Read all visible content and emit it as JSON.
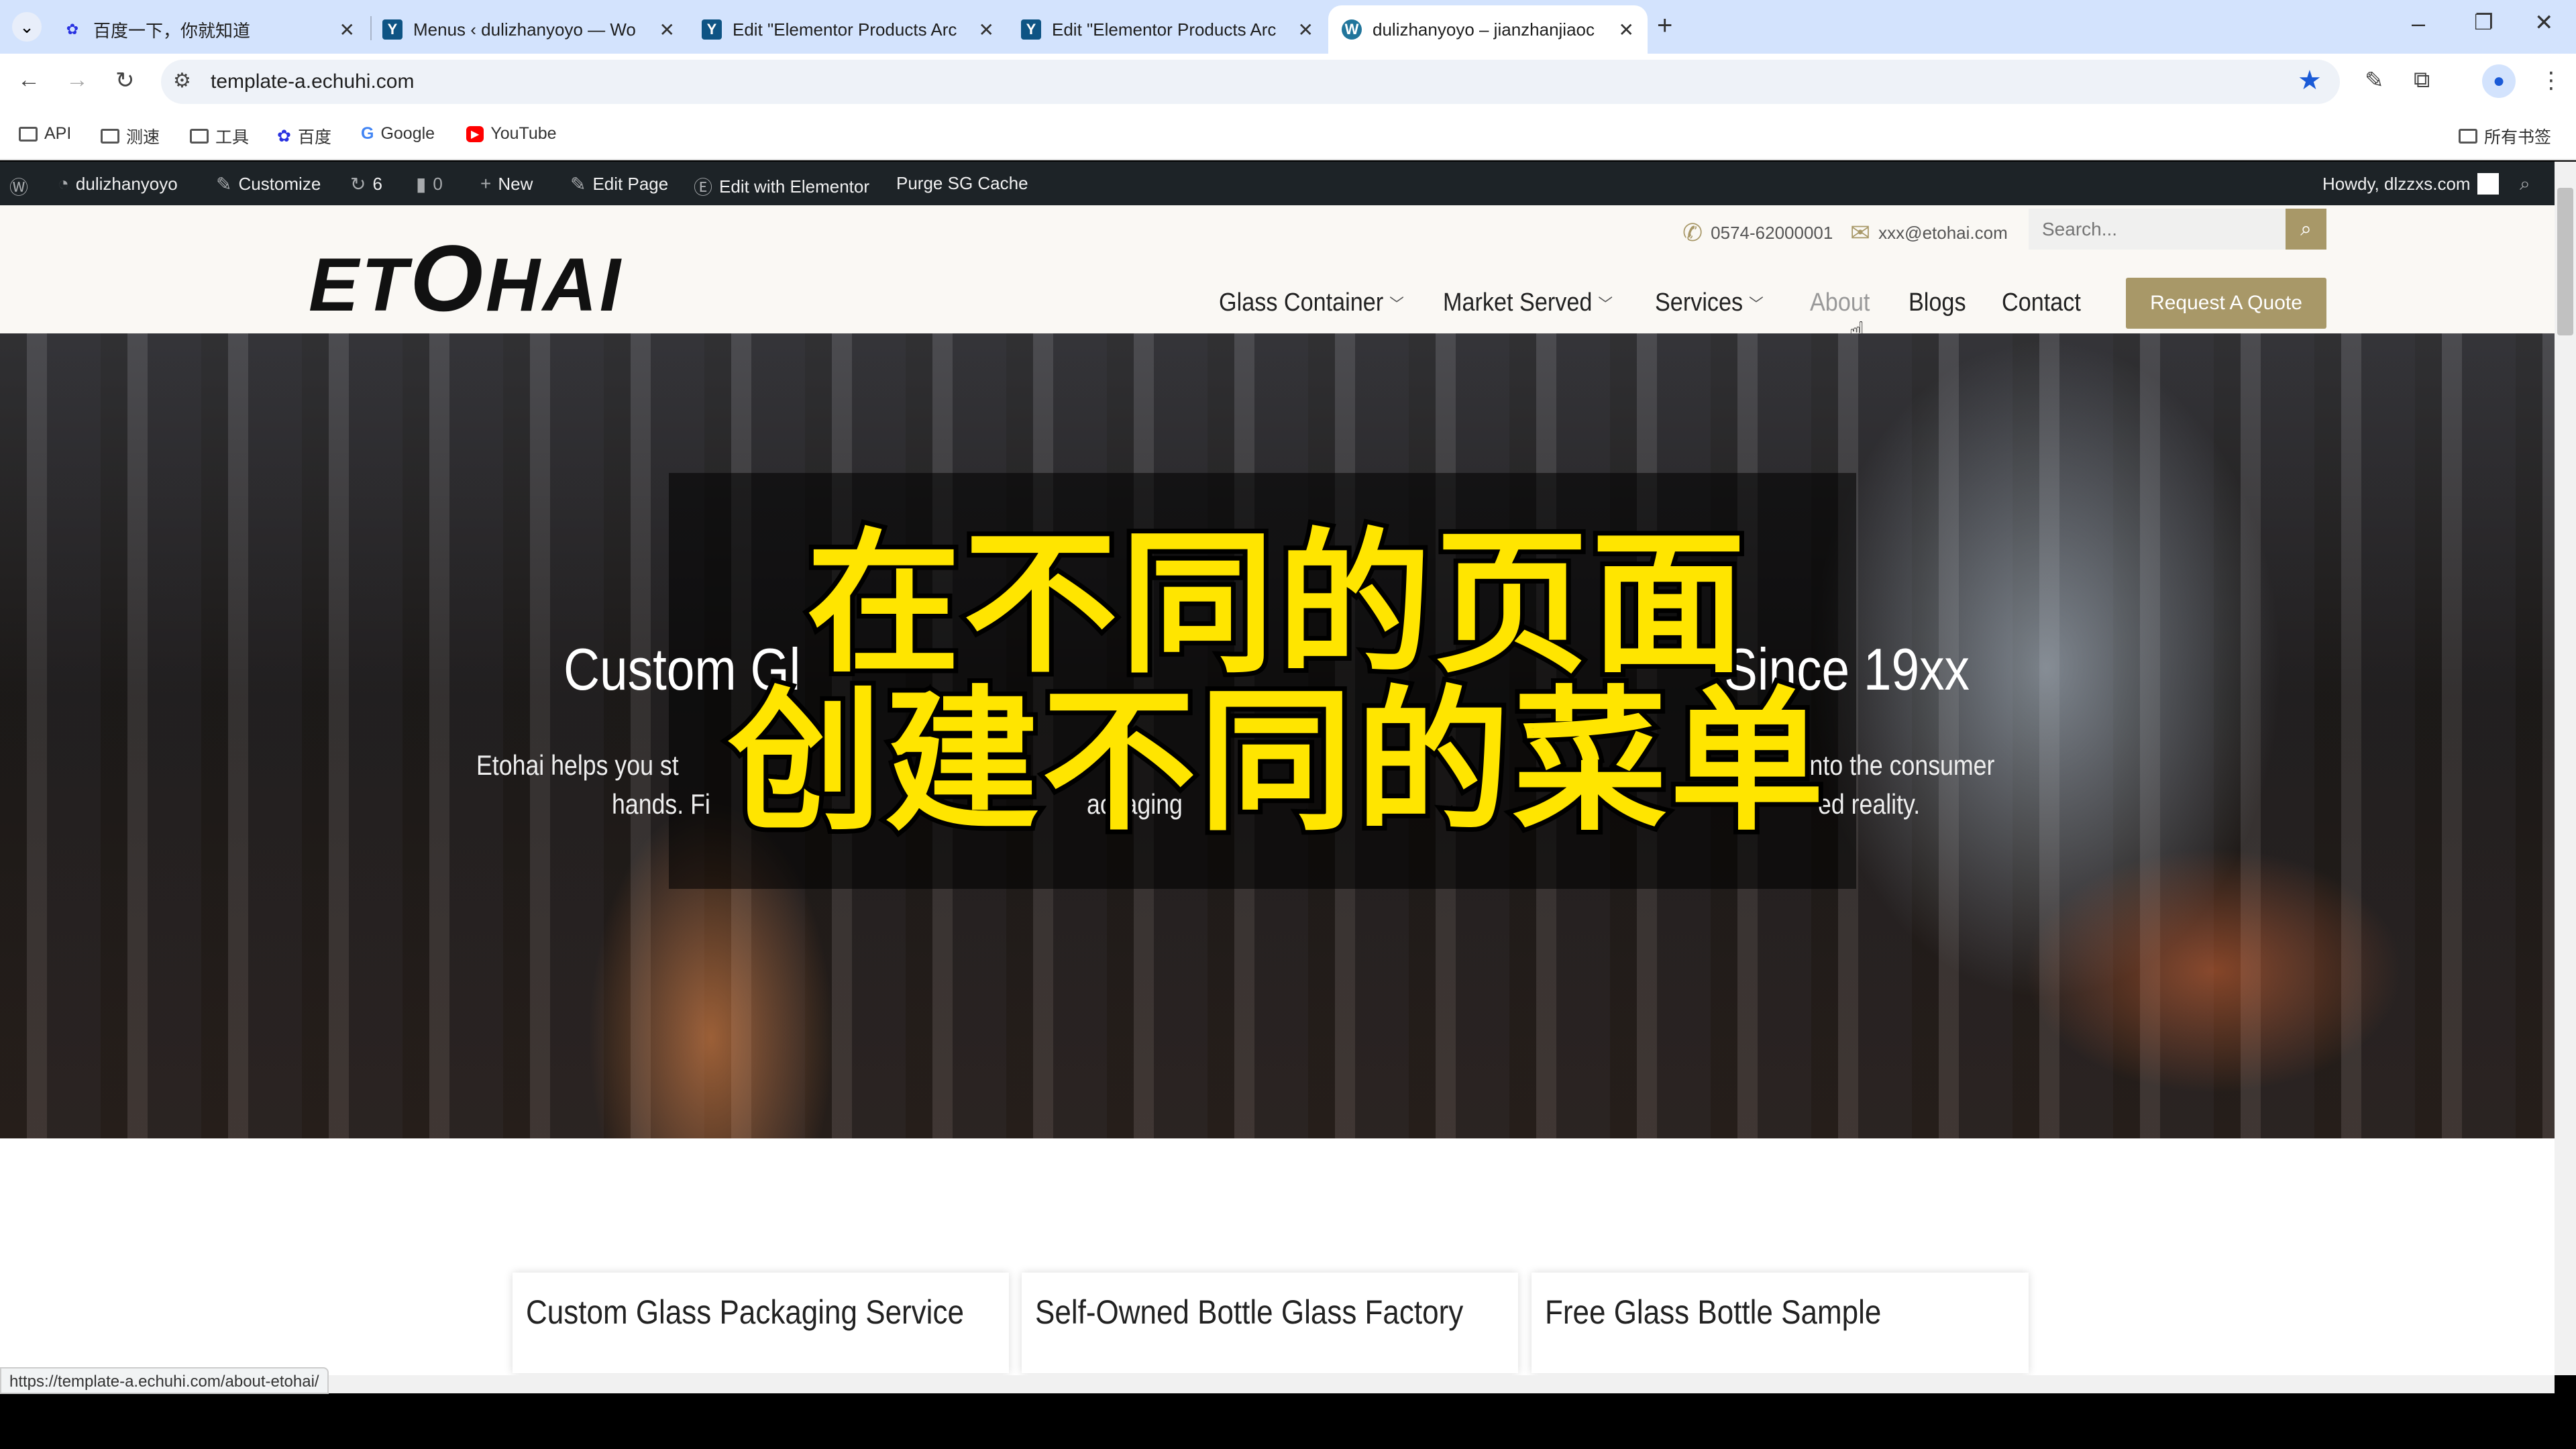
{
  "browser": {
    "tabs": [
      {
        "title": "百度一下，你就知道",
        "icon": "baidu-icon",
        "active": false
      },
      {
        "title": "Menus ‹ dulizhanyoyo — Wo",
        "icon": "yoast-icon",
        "active": false
      },
      {
        "title": "Edit \"Elementor Products Arc",
        "icon": "yoast-icon",
        "active": false
      },
      {
        "title": "Edit \"Elementor Products Arc",
        "icon": "yoast-icon",
        "active": false
      },
      {
        "title": "dulizhanyoyo – jianzhanjiaoc",
        "icon": "wordpress-icon",
        "active": true
      }
    ],
    "url": "template-a.echuhi.com",
    "bookmarks": [
      {
        "label": "API",
        "icon": "folder-icon"
      },
      {
        "label": "测速",
        "icon": "folder-icon"
      },
      {
        "label": "工具",
        "icon": "folder-icon"
      },
      {
        "label": "百度",
        "icon": "baidu-icon"
      },
      {
        "label": "Google",
        "icon": "google-icon"
      },
      {
        "label": "YouTube",
        "icon": "youtube-icon"
      }
    ],
    "all_bookmarks": "所有书签",
    "status_url": "https://template-a.echuhi.com/about-etohai/"
  },
  "adminbar": {
    "site": "dulizhanyoyo",
    "customize": "Customize",
    "updates": "6",
    "comments": "0",
    "new": "New",
    "edit_page": "Edit Page",
    "elementor": "Edit with Elementor",
    "purge": "Purge SG Cache",
    "howdy": "Howdy, dlzzxs.com"
  },
  "site": {
    "logo": "ETOHAI",
    "phone": "0574-62000001",
    "email": "xxx@etohai.com",
    "search_placeholder": "Search...",
    "nav": [
      {
        "label": "Glass Container",
        "dropdown": true
      },
      {
        "label": "Market Served",
        "dropdown": true
      },
      {
        "label": "Services",
        "dropdown": true
      },
      {
        "label": "About",
        "dropdown": false,
        "hover": true
      },
      {
        "label": "Blogs",
        "dropdown": false
      },
      {
        "label": "Contact",
        "dropdown": false
      }
    ],
    "quote_button": "Request A Quote",
    "accent": "#a89868"
  },
  "hero": {
    "heading_left": "Custom Gl",
    "heading_right": "Since 19xx",
    "para1_left": "Etohai helps you st",
    "para1_right": "nd into the consumer",
    "para2_left": "hands. Fi",
    "para2_mid": "ackaging",
    "para2_right": "ed reality."
  },
  "caption": {
    "line1": "在不同的页面",
    "line2": "创建不同的菜单",
    "color": "#ffe500"
  },
  "cards": [
    "Custom Glass Packaging Service",
    "Self-Owned Bottle Glass Factory",
    "Free Glass Bottle Sample"
  ]
}
